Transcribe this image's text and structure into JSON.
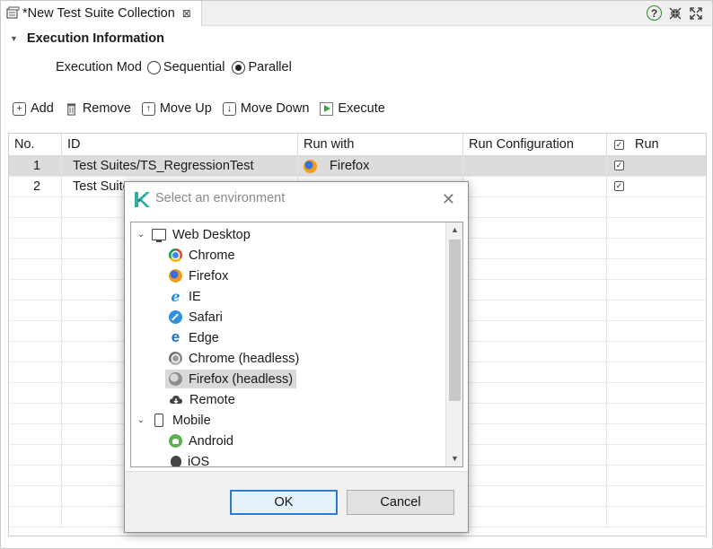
{
  "tab": {
    "title": "*New Test Suite Collection",
    "close": "⊠"
  },
  "section": {
    "title": "Execution Information"
  },
  "execution_mode": {
    "label": "Execution Mod",
    "options": [
      {
        "label": "Sequential",
        "selected": false
      },
      {
        "label": "Parallel",
        "selected": true
      }
    ]
  },
  "toolbar": {
    "add": "Add",
    "remove": "Remove",
    "move_up": "Move Up",
    "move_down": "Move Down",
    "execute": "Execute"
  },
  "table": {
    "columns": [
      "No.",
      "ID",
      "Run with",
      "Run Configuration",
      "Run"
    ],
    "rows": [
      {
        "no": "1",
        "id": "Test Suites/TS_RegressionTest",
        "run_with": "Firefox",
        "run_with_icon": "firefox-icon",
        "run_config": "",
        "run": true,
        "selected": true
      },
      {
        "no": "2",
        "id": "Test Suite",
        "run_with": "",
        "run_with_icon": "",
        "run_config": "",
        "run": true,
        "selected": false
      }
    ]
  },
  "dialog": {
    "title": "Select an environment",
    "tree": [
      {
        "label": "Web Desktop",
        "icon": "monitor-icon",
        "level": 0,
        "expanded": true
      },
      {
        "label": "Chrome",
        "icon": "chrome-icon",
        "level": 1
      },
      {
        "label": "Firefox",
        "icon": "firefox-icon",
        "level": 1
      },
      {
        "label": "IE",
        "icon": "ie-icon",
        "level": 1
      },
      {
        "label": "Safari",
        "icon": "safari-icon",
        "level": 1
      },
      {
        "label": "Edge",
        "icon": "edge-icon",
        "level": 1
      },
      {
        "label": "Chrome (headless)",
        "icon": "chrome-headless-icon",
        "level": 1
      },
      {
        "label": "Firefox (headless)",
        "icon": "firefox-headless-icon",
        "level": 1,
        "selected": true
      },
      {
        "label": "Remote",
        "icon": "remote-cloud-icon",
        "level": 1
      },
      {
        "label": "Mobile",
        "icon": "phone-icon",
        "level": 0,
        "expanded": true
      },
      {
        "label": "Android",
        "icon": "android-icon",
        "level": 1
      },
      {
        "label": "iOS",
        "icon": "apple-icon",
        "level": 1
      }
    ],
    "ok": "OK",
    "cancel": "Cancel"
  }
}
